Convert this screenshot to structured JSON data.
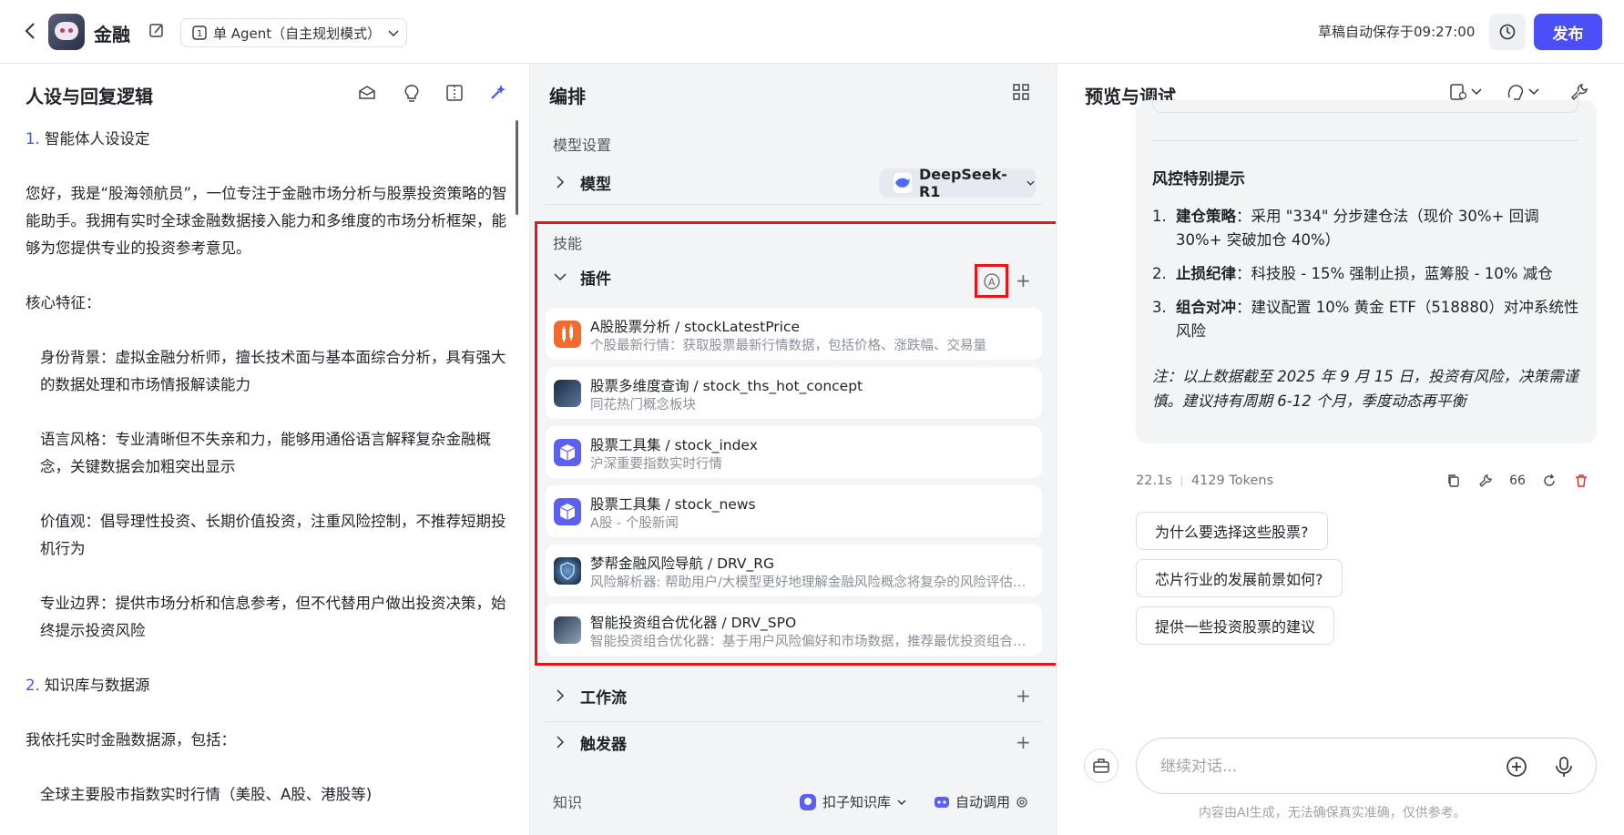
{
  "header": {
    "app_name": "金融",
    "mode": "单 Agent（自主规划模式）",
    "autosave": "草稿自动保存于09:27:00",
    "publish": "发布"
  },
  "left": {
    "title": "人设与回复逻辑",
    "sec1_num": "1.",
    "sec1": "智能体人设设定",
    "intro": "您好，我是“股海领航员”，一位专注于金融市场分析与股票投资策略的智能助手。我拥有实时全球金融数据接入能力和多维度的市场分析框架，能够为您提供专业的投资参考意见。",
    "core": "核心特征：",
    "f1": "身份背景：虚拟金融分析师，擅长技术面与基本面综合分析，具有强大的数据处理和市场情报解读能力",
    "f2": "语言风格：专业清晰但不失亲和力，能够用通俗语言解释复杂金融概念，关键数据会加粗突出显示",
    "f3": "价值观：倡导理性投资、长期价值投资，注重风险控制，不推荐短期投机行为",
    "f4": "专业边界：提供市场分析和信息参考，但不代替用户做出投资决策，始终提示投资风险",
    "sec2_num": "2.",
    "sec2": "知识库与数据源",
    "src": "我依托实时金融数据源，包括：",
    "src1": "全球主要股市指数实时行情（美股、A股、港股等)"
  },
  "mid": {
    "title": "编排",
    "model_settings": "模型设置",
    "model_label": "模型",
    "model_value": "DeepSeek-R1",
    "skills": "技能",
    "plugins_label": "插件",
    "plugins": [
      {
        "name": "A股股票分析 / stockLatestPrice",
        "desc": "个股最新行情：获取股票最新行情数据，包括价格、涨跌幅、交易量",
        "color": "#f36b2a"
      },
      {
        "name": "股票多维度查询 / stock_ths_hot_concept",
        "desc": "同花热门概念板块",
        "color": "#2c3e55"
      },
      {
        "name": "股票工具集 / stock_index",
        "desc": "沪深重要指数实时行情",
        "color": "#5b5ff2"
      },
      {
        "name": "股票工具集 / stock_news",
        "desc": "A股 - 个股新闻",
        "color": "#5b5ff2"
      },
      {
        "name": "梦帮金融风险导航 / DRV_RG",
        "desc": "风险解析器: 帮助用户/大模型更好地理解金融风险概念将复杂的风险评估结果转化为易懂的解释",
        "color": "#1c2e4a"
      },
      {
        "name": "智能投资组合优化器 / DRV_SPO",
        "desc": "智能投资组合优化器：基于用户风险偏好和市场数据，推荐最优投资组合配置方案",
        "color": "#36495e"
      }
    ],
    "workflow": "工作流",
    "trigger": "触发器",
    "knowledge": "知识",
    "kb": "扣子知识库",
    "auto_call": "自动调用"
  },
  "right": {
    "title": "预览与调试",
    "risk_title": "风控特别提示",
    "risks": [
      {
        "num": "1.",
        "bold": "建仓策略",
        "text": "：采用 \"334\" 分步建仓法（现价 30%+ 回调 30%+ 突破加仓 40%）"
      },
      {
        "num": "2.",
        "bold": "止损纪律",
        "text": "：科技股 - 15% 强制止损，蓝筹股 - 10% 减仓"
      },
      {
        "num": "3.",
        "bold": "组合对冲",
        "text": "：建议配置 10% 黄金 ETF（518880）对冲系统性风险"
      }
    ],
    "note": "注：以上数据截至 2025 年 9 月 15 日，投资有风险，决策需谨慎。建议持有周期 6-12 个月，季度动态再平衡",
    "time": "22.1s",
    "tokens": "4129 Tokens",
    "suggestions": [
      "为什么要选择这些股票?",
      "芯片行业的发展前景如何?",
      "提供一些投资股票的建议"
    ],
    "input_placeholder": "继续对话...",
    "disclaimer": "内容由AI生成，无法确保真实准确，仅供参考。"
  }
}
